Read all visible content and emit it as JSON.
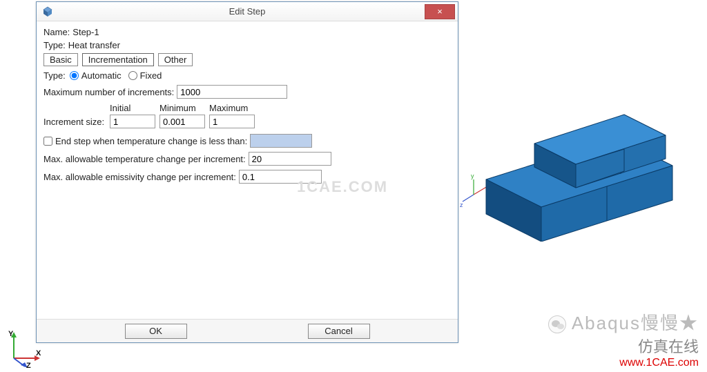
{
  "dialog": {
    "title": "Edit Step",
    "close_glyph": "×",
    "name_label": "Name:",
    "name_value": "Step-1",
    "type_label": "Type:",
    "type_value": "Heat transfer",
    "tabs": {
      "basic": "Basic",
      "incrementation": "Incrementation",
      "other": "Other"
    },
    "inc_type_label": "Type:",
    "inc_type_auto": "Automatic",
    "inc_type_fixed": "Fixed",
    "max_inc_label": "Maximum number of increments:",
    "max_inc_value": "1000",
    "col_initial": "Initial",
    "col_min": "Minimum",
    "col_max": "Maximum",
    "inc_size_label": "Increment size:",
    "inc_initial": "1",
    "inc_min": "0.001",
    "inc_max": "1",
    "end_step_label": "End step when temperature change is less than:",
    "end_step_value": "",
    "max_temp_label": "Max. allowable temperature change per increment:",
    "max_temp_value": "20",
    "max_emis_label": "Max. allowable emissivity change per increment:",
    "max_emis_value": "0.1",
    "ok": "OK",
    "cancel": "Cancel"
  },
  "viewport": {
    "axis_small_x": "x",
    "axis_small_y": "y",
    "axis_small_z": "z"
  },
  "triad": {
    "x": "X",
    "y": "Y",
    "z": "Z"
  },
  "watermark": {
    "center": "1CAE.COM",
    "brand1": "Abaqus慢慢★",
    "brand2": "仿真在线",
    "url": "www.1CAE.com"
  }
}
